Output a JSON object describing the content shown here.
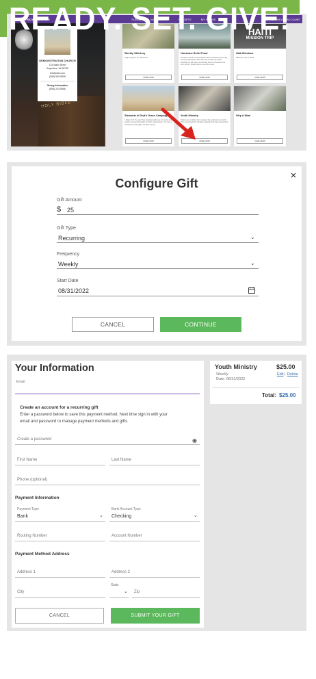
{
  "panel1": {
    "topbar": {
      "brand": "DEMONSTRATION CHURCH",
      "nav": [
        "FUNDS",
        "MY ACCOUNT",
        "MY GIFTS",
        "MY FORMS"
      ],
      "sign": "SIGN IN | CREATE ACCOUNT"
    },
    "church": {
      "name": "DEMONSTRATION CHURCH",
      "address1": "123 Main Street",
      "address2": "Anywhere, IN 98765",
      "email": "info@site.com",
      "phone": "(555) 555-5555",
      "giving_label": "Giving Information",
      "giving_phone": "(855) 234-5566"
    },
    "bible_text": "HOLY BIBLE",
    "cards": [
      {
        "title": "Weekly Offertory",
        "desc": "Help support our Mission!!",
        "btn": "GIVE NOW"
      },
      {
        "title": "Hurricane Relief Fund",
        "desc": "Hurricane Jacob moved landfall in North Carolina early Friday morning, lashing the state with rain and 90 mph winds knocking out the power and leaving dozens of residents far from access. Please help us meet the needs.",
        "btn": "GIVE NOW"
      },
      {
        "title": "Haiti Missions",
        "desc": "Mission Trip to Haiti",
        "btn": "GIVE NOW",
        "img_text1": "HAITI",
        "img_text2": "MISSION TRIP"
      },
      {
        "title": "Stewards of God's Grace Campaign",
        "desc": "1 Peter 4:10 \"As each has received a gift, use it to serve one another, as good stewards of God's varied grace.\" You are a steward of God's gifts; use them wisely.",
        "btn": "GIVE NOW"
      },
      {
        "title": "Youth Ministry",
        "desc": "Please give to this fund to support the youth at our church. They need funds for ministry meetings and their annual trips!",
        "btn": "GIVE NOW"
      },
      {
        "title": "Skip A Meal",
        "desc": "",
        "btn": "GIVE NOW"
      }
    ]
  },
  "dialog": {
    "title": "Configure Gift",
    "close": "×",
    "amount_label": "Gift Amount",
    "currency": "$",
    "amount": "25",
    "type_label": "Gift Type",
    "type_value": "Recurring",
    "freq_label": "Frequency",
    "freq_value": "Weekly",
    "date_label": "Start Date",
    "date_value": "08/31/2022",
    "cancel": "CANCEL",
    "continue": "CONTINUE"
  },
  "form": {
    "title": "Your Information",
    "email_label": "Email",
    "account_heading": "Create an account for a recurring gift",
    "account_text1": "Enter a password below to save this payment method. Next time sign in with your",
    "account_text2": "email and password to manage payment methods and gifts.",
    "password_ph": "Create a password",
    "first_name_ph": "First Name",
    "last_name_ph": "Last Name",
    "phone_ph": "Phone (optional)",
    "payment_heading": "Payment Information",
    "payment_type_label": "Payment Type",
    "payment_type": "Bank",
    "account_type_label": "Bank Account Type",
    "account_type": "Checking",
    "routing_ph": "Routing Number",
    "account_ph": "Account Number",
    "address_heading": "Payment Method Address",
    "address1_ph": "Address 1",
    "address2_ph": "Address 2",
    "city_ph": "City",
    "state_label": "State",
    "zip_ph": "Zip",
    "cancel": "CANCEL",
    "submit": "SUBMIT YOUR GIFT"
  },
  "summary": {
    "fund": "Youth Ministry",
    "amount": "$25.00",
    "frequency": "Weekly",
    "date": "Date: 08/31/2022",
    "edit": "Edit",
    "sep": "|",
    "delete": "Delete",
    "total_label": "Total:",
    "total": "$25.00"
  },
  "banner": "READY. SET. GIVE!",
  "colors": {
    "topbar": "#5b3a93",
    "green": "#5cb85c",
    "banner": "#7ab648",
    "link": "#3a6fb0"
  }
}
